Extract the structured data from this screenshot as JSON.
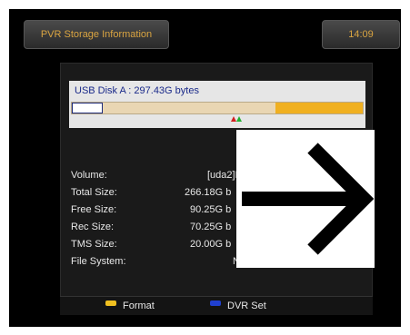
{
  "header": {
    "title": "PVR Storage Information",
    "clock": "14:09"
  },
  "disk": {
    "label": "USB Disk A : 297.43G bytes",
    "used_fraction_yellow": 0.3,
    "other_fraction": 0.105,
    "colors": {
      "bar_bg": "#e9d6b3",
      "used": "#f0b020",
      "border": "#1d2b7a"
    }
  },
  "info": {
    "labels": {
      "volume": "Volume:",
      "total": "Total Size:",
      "free": "Free Size:",
      "rec": "Rec Size:",
      "tms": "TMS Size:",
      "fs": "File System:"
    },
    "values": {
      "volume": "[uda2]M",
      "total": "266.18G b",
      "free": "90.25G b",
      "rec": "70.25G b",
      "tms": "20.00G b",
      "fs": "N"
    }
  },
  "footer": {
    "format_label": "Format",
    "dvr_label": "DVR Set",
    "format_color": "#f0c020",
    "dvr_color": "#2040d0"
  },
  "overlay_icon": "right-arrow-icon"
}
